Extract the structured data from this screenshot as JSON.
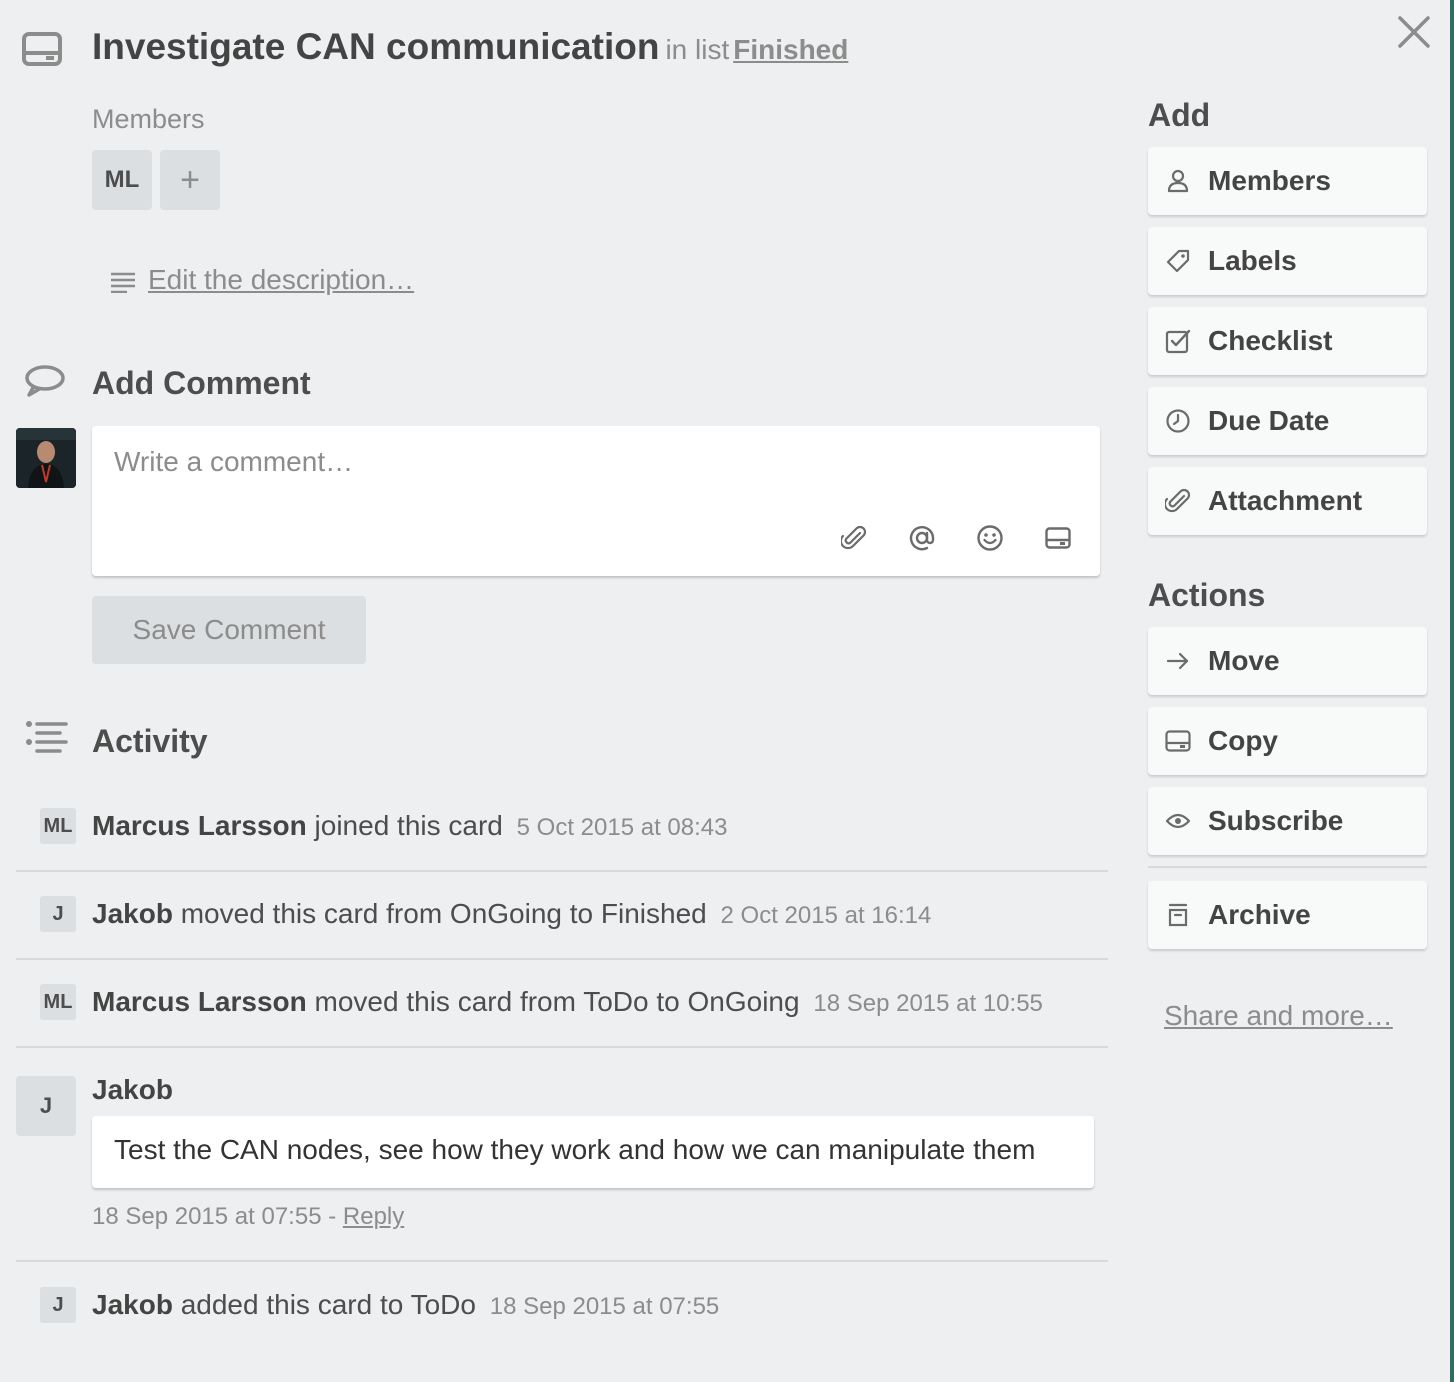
{
  "card": {
    "title": "Investigate CAN communication",
    "in_list_prefix": "in list",
    "list_name": "Finished"
  },
  "members": {
    "label": "Members",
    "items": [
      {
        "initials": "ML"
      }
    ],
    "add_symbol": "+"
  },
  "description": {
    "edit_link": "Edit the description…"
  },
  "comment": {
    "section_title": "Add Comment",
    "placeholder": "Write a comment…",
    "save_label": "Save Comment"
  },
  "activity": {
    "section_title": "Activity",
    "entries": [
      {
        "initials": "ML",
        "user": "Marcus Larsson",
        "action": "joined this card",
        "time": "5 Oct 2015 at 08:43"
      },
      {
        "initials": "J",
        "user": "Jakob",
        "action": "moved this card from OnGoing to Finished",
        "time": "2 Oct 2015 at 16:14"
      },
      {
        "initials": "ML",
        "user": "Marcus Larsson",
        "action": "moved this card from ToDo to OnGoing",
        "time": "18 Sep 2015 at 10:55"
      },
      {
        "initials": "J",
        "user": "Jakob",
        "comment": "Test the CAN nodes, see how they work and how we can manipulate them",
        "time": "18 Sep 2015 at 07:55",
        "separator": "-",
        "reply_label": "Reply"
      },
      {
        "initials": "J",
        "user": "Jakob",
        "action": "added this card to ToDo",
        "time": "18 Sep 2015 at 07:55"
      }
    ]
  },
  "sidebar": {
    "add_title": "Add",
    "add_buttons": [
      {
        "label": "Members",
        "icon": "person-icon"
      },
      {
        "label": "Labels",
        "icon": "tag-icon"
      },
      {
        "label": "Checklist",
        "icon": "checkbox-icon"
      },
      {
        "label": "Due Date",
        "icon": "clock-icon"
      },
      {
        "label": "Attachment",
        "icon": "paperclip-icon"
      }
    ],
    "actions_title": "Actions",
    "action_buttons": [
      {
        "label": "Move",
        "icon": "arrow-right-icon"
      },
      {
        "label": "Copy",
        "icon": "card-icon"
      },
      {
        "label": "Subscribe",
        "icon": "eye-icon"
      },
      {
        "label": "Archive",
        "icon": "archive-icon"
      }
    ],
    "share_link": "Share and more…"
  },
  "colors": {
    "background": "#edeff0",
    "button_bg": "#f8f9f9",
    "muted_text": "#8c8c8c",
    "accent_edge": "#2f6f60"
  }
}
